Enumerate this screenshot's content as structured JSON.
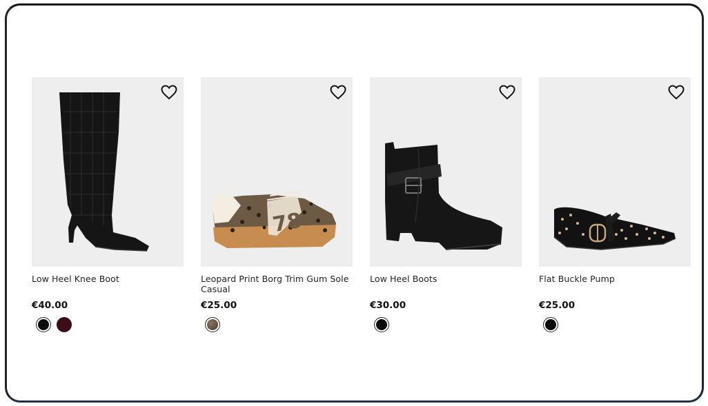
{
  "products": [
    {
      "name": "Low Heel Knee Boot",
      "price": "€40.00",
      "image_icon": "knee-boot-image",
      "swatches": [
        {
          "name": "Black",
          "color": "#0b0b0b"
        },
        {
          "name": "Burgundy",
          "color": "#3a0f16"
        }
      ]
    },
    {
      "name": "Leopard Print Borg Trim Gum Sole Casual",
      "price": "€25.00",
      "image_icon": "leopard-trainer-image",
      "swatches": [
        {
          "name": "Leopard",
          "color": "#6b5a48"
        }
      ]
    },
    {
      "name": "Low Heel Boots",
      "price": "€30.00",
      "image_icon": "ankle-boot-image",
      "swatches": [
        {
          "name": "Black",
          "color": "#0b0b0b"
        }
      ]
    },
    {
      "name": "Flat Buckle Pump",
      "price": "€25.00",
      "image_icon": "flat-pump-image",
      "swatches": [
        {
          "name": "Black",
          "color": "#0b0b0b"
        }
      ]
    }
  ],
  "colors": {
    "image_bg": "#eeeeef",
    "text": "#222222",
    "frame": "#161616"
  }
}
